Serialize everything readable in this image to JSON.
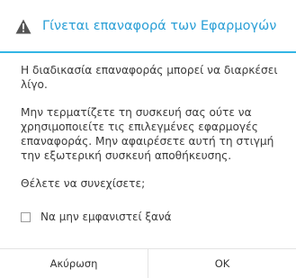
{
  "dialog": {
    "title": "Γίνεται επαναφορά των Εφαρμογών",
    "title_icon": "warning-icon",
    "accent_color": "#33b5e5",
    "paragraphs": [
      "Η διαδικασία επαναφοράς μπορεί να διαρκέσει λίγο.",
      "Μην τερματίζετε τη συσκευή σας ούτε να χρησιμοποιείτε τις επιλεγμένες εφαρμογές επαναφοράς. Μην αφαιρέσετε αυτή τη στιγμή την εξωτερική συσκευή αποθήκευσης.",
      "Θέλετε να συνεχίσετε;"
    ],
    "checkbox": {
      "label": "Να μην εμφανιστεί ξανά",
      "checked": false
    },
    "buttons": {
      "cancel_label": "Ακύρωση",
      "ok_label": "OK"
    }
  }
}
